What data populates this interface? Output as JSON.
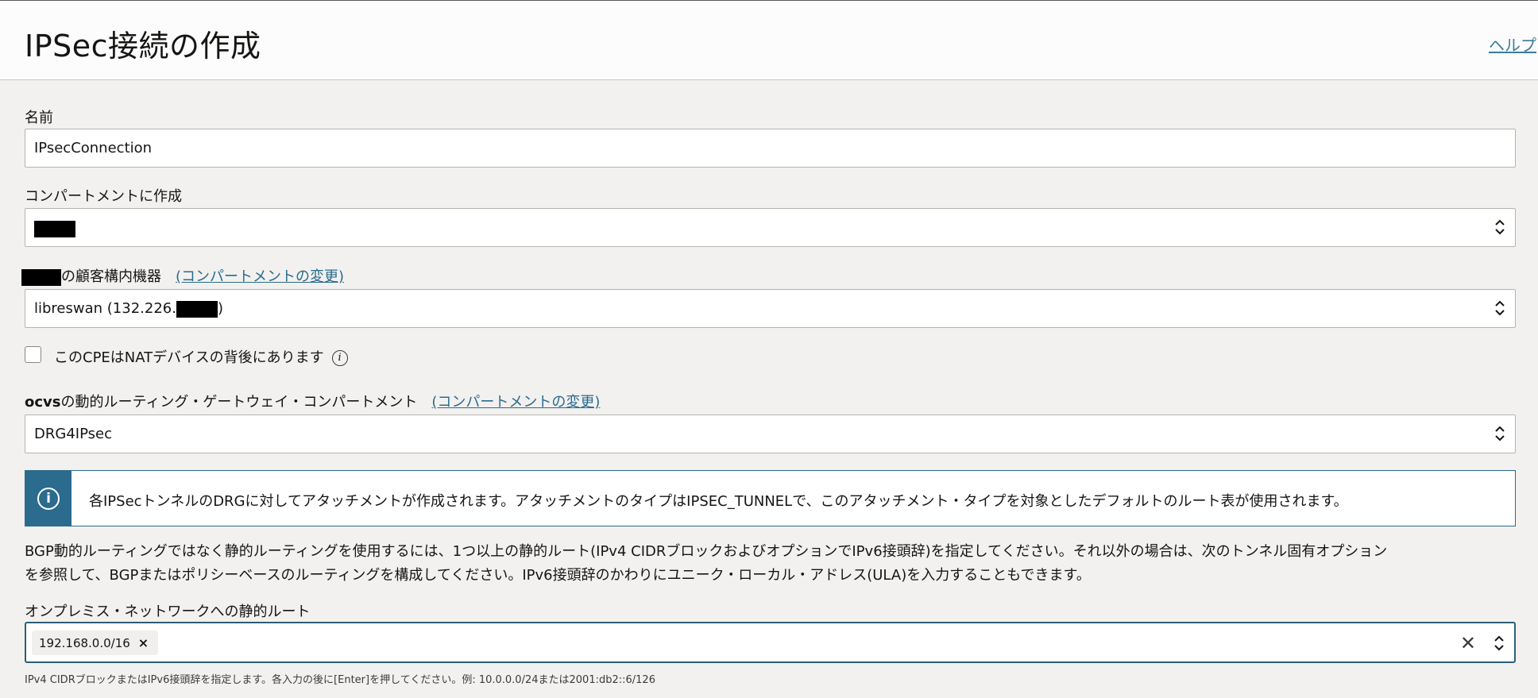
{
  "header": {
    "title": "IPSec接続の作成",
    "help_label": "ヘルプ"
  },
  "form": {
    "name": {
      "label": "名前",
      "value": "IPsecConnection"
    },
    "compartment": {
      "label": "コンパートメントに作成"
    },
    "cpe": {
      "label": "の顧客構内機器",
      "change_link": "(コンパートメントの変更)",
      "value_prefix": "libreswan (132.226.",
      "value_suffix": ")"
    },
    "nat_checkbox": {
      "label": "このCPEはNATデバイスの背後にあります",
      "checked": false
    },
    "drg": {
      "label_bold": "ocvs",
      "label": "の動的ルーティング・ゲートウェイ・コンパートメント",
      "change_link": "(コンパートメントの変更)",
      "value": "DRG4IPsec"
    },
    "info_banner": {
      "message": "各IPSecトンネルのDRGに対してアタッチメントが作成されます。アタッチメントのタイプはIPSEC_TUNNELで、このアタッチメント・タイプを対象としたデフォルトのルート表が使用されます。"
    },
    "description": {
      "line1": "BGP動的ルーティングではなく静的ルーティングを使用するには、1つ以上の静的ルート(IPv4 CIDRブロックおよびオプションでIPv6接頭辞)を指定してください。それ以外の場合は、次のトンネル固有オプション",
      "line2": "を参照して、BGPまたはポリシーベースのルーティングを構成してください。IPv6接頭辞のかわりにユニーク・ローカル・アドレス(ULA)を入力することもできます。"
    },
    "static_routes": {
      "label": "オンプレミス・ネットワークへの静的ルート",
      "chips": [
        "192.168.0.0/16"
      ],
      "hint": "IPv4 CIDRブロックまたはIPv6接頭辞を指定します。各入力の後に[Enter]を押してください。例: 10.0.0.0/24または2001:db2::6/126"
    }
  },
  "icons": {
    "chevron": "chevron-up-down-icon",
    "info": "info-icon",
    "clear": "close-icon"
  },
  "colors": {
    "accent": "#2a6b8e",
    "background": "#f2f1ef"
  }
}
